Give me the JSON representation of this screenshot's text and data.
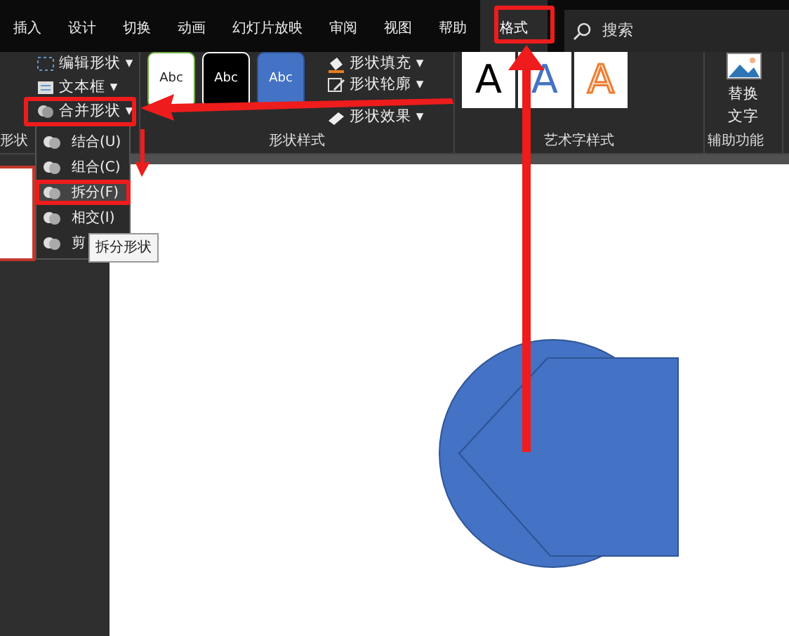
{
  "tabs": [
    {
      "label": "插入",
      "selected": false
    },
    {
      "label": "设计",
      "selected": false
    },
    {
      "label": "切换",
      "selected": false
    },
    {
      "label": "动画",
      "selected": false
    },
    {
      "label": "幻灯片放映",
      "selected": false
    },
    {
      "label": "审阅",
      "selected": false
    },
    {
      "label": "视图",
      "selected": false
    },
    {
      "label": "帮助",
      "selected": false
    },
    {
      "label": "格式",
      "selected": true
    }
  ],
  "search": {
    "placeholder": "搜索"
  },
  "ribbon": {
    "insert_group": {
      "label": "形状",
      "buttons": [
        {
          "label": "编辑形状",
          "caret": "▾"
        },
        {
          "label": "文本框",
          "caret": "▾"
        },
        {
          "label": "合并形状",
          "caret": "▾"
        }
      ]
    },
    "shape_styles": {
      "label": "形状样式",
      "presets": [
        {
          "text": "Abc",
          "kind": "outline"
        },
        {
          "text": "Abc",
          "kind": "dark"
        },
        {
          "text": "Abc",
          "kind": "blue"
        }
      ],
      "buttons": [
        {
          "label": "形状填充",
          "caret": "▾"
        },
        {
          "label": "形状轮廓",
          "caret": "▾"
        },
        {
          "label": "形状效果",
          "caret": "▾"
        }
      ]
    },
    "wordart_styles": {
      "label": "艺术字样式",
      "presets": [
        {
          "text": "A",
          "kind": "dark"
        },
        {
          "text": "A",
          "kind": "blue"
        },
        {
          "text": "A",
          "kind": "orange"
        }
      ]
    },
    "accessibility": {
      "label": "辅助功能",
      "button": "替换文字"
    }
  },
  "merge_menu": {
    "items": [
      {
        "label": "结合(U)",
        "selected": false
      },
      {
        "label": "组合(C)",
        "selected": false
      },
      {
        "label": "拆分(F)",
        "selected": true
      },
      {
        "label": "相交(I)",
        "selected": false
      },
      {
        "label": "剪",
        "selected": false
      }
    ]
  },
  "tooltip": "拆分形状"
}
